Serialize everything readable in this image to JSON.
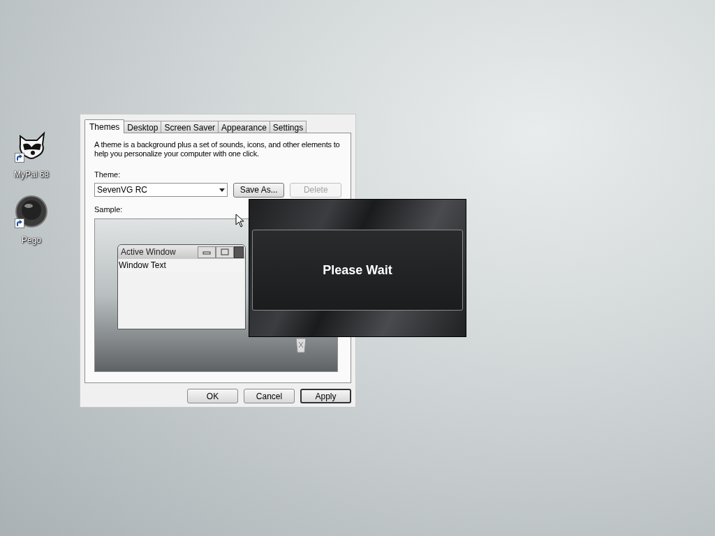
{
  "desktop_icons": [
    {
      "label": "MyPal 68",
      "kind": "raccoon"
    },
    {
      "label": "Pego",
      "kind": "ball"
    }
  ],
  "dialog": {
    "tabs": [
      {
        "label": "Themes",
        "selected": true
      },
      {
        "label": "Desktop",
        "selected": false
      },
      {
        "label": "Screen Saver",
        "selected": false
      },
      {
        "label": "Appearance",
        "selected": false
      },
      {
        "label": "Settings",
        "selected": false
      }
    ],
    "description": "A theme is a background plus a set of sounds, icons, and other elements to help you personalize your computer with one click.",
    "theme_label": "Theme:",
    "theme_value": "SevenVG RC",
    "buttons": [
      {
        "label": "Save As...",
        "disabled": false
      },
      {
        "label": "Delete",
        "disabled": true
      }
    ],
    "sample_label": "Sample:",
    "sample": {
      "window_title": "Active Window",
      "window_text": "Window Text"
    },
    "footer_buttons": [
      {
        "label": "OK",
        "focused": false
      },
      {
        "label": "Cancel",
        "focused": false
      },
      {
        "label": "Apply",
        "focused": true
      }
    ]
  },
  "overlay": {
    "message": "Please Wait"
  }
}
